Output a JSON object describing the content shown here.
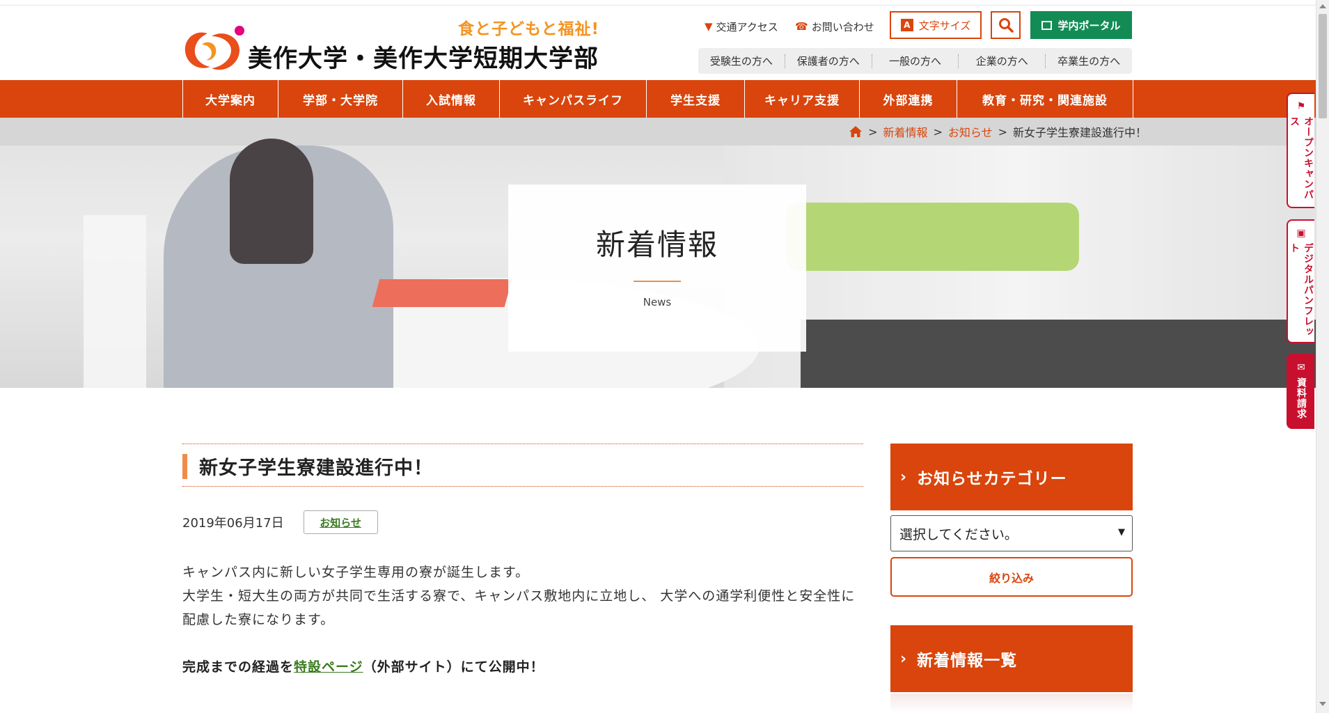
{
  "header": {
    "tagline": "食と子どもと福祉!",
    "logo_text": "美作大学・美作大学短期大学部",
    "access_label": "交通アクセス",
    "contact_label": "お問い合わせ",
    "fontsize_label": "文字サイズ",
    "fontsize_icon_letter": "A",
    "portal_label": "学内ポータル",
    "audience": [
      "受験生の方へ",
      "保護者の方へ",
      "一般の方へ",
      "企業の方へ",
      "卒業生の方へ"
    ]
  },
  "nav": [
    "大学案内",
    "学部・大学院",
    "入試情報",
    "キャンパスライフ",
    "学生支援",
    "キャリア支援",
    "外部連携",
    "教育・研究・関連施設"
  ],
  "breadcrumb": {
    "news": "新着情報",
    "notice": "お知らせ",
    "current": "新女子学生寮建設進行中！",
    "sep": ">"
  },
  "hero": {
    "title": "新着情報",
    "subtitle": "News"
  },
  "article": {
    "title": "新女子学生寮建設進行中！",
    "date": "2019年06月17日",
    "category": "お知らせ",
    "p1": "キャンパス内に新しい女子学生専用の寮が誕生します。",
    "p2": "大学生・短大生の両方が共同で生活する寮で、キャンパス敷地内に立地し、 大学への通学利便性と安全性に配慮した寮になります。",
    "p3_before": "完成までの経過を",
    "p3_link": "特設ページ",
    "p3_after": "（外部サイト）にて公開中！"
  },
  "sidebar": {
    "category_heading": "お知らせカテゴリー",
    "select_value": "選択してください。",
    "filter_label": "絞り込み",
    "news_list_heading": "新着情報一覧"
  },
  "side_tabs": {
    "open_campus": "オープンキャンパス",
    "digital": "デジタルパンフレット",
    "request": "資料請求"
  },
  "colors": {
    "brand": "#d9450c",
    "accent": "#f39422",
    "portal": "#138b55",
    "tab": "#c8102e"
  }
}
